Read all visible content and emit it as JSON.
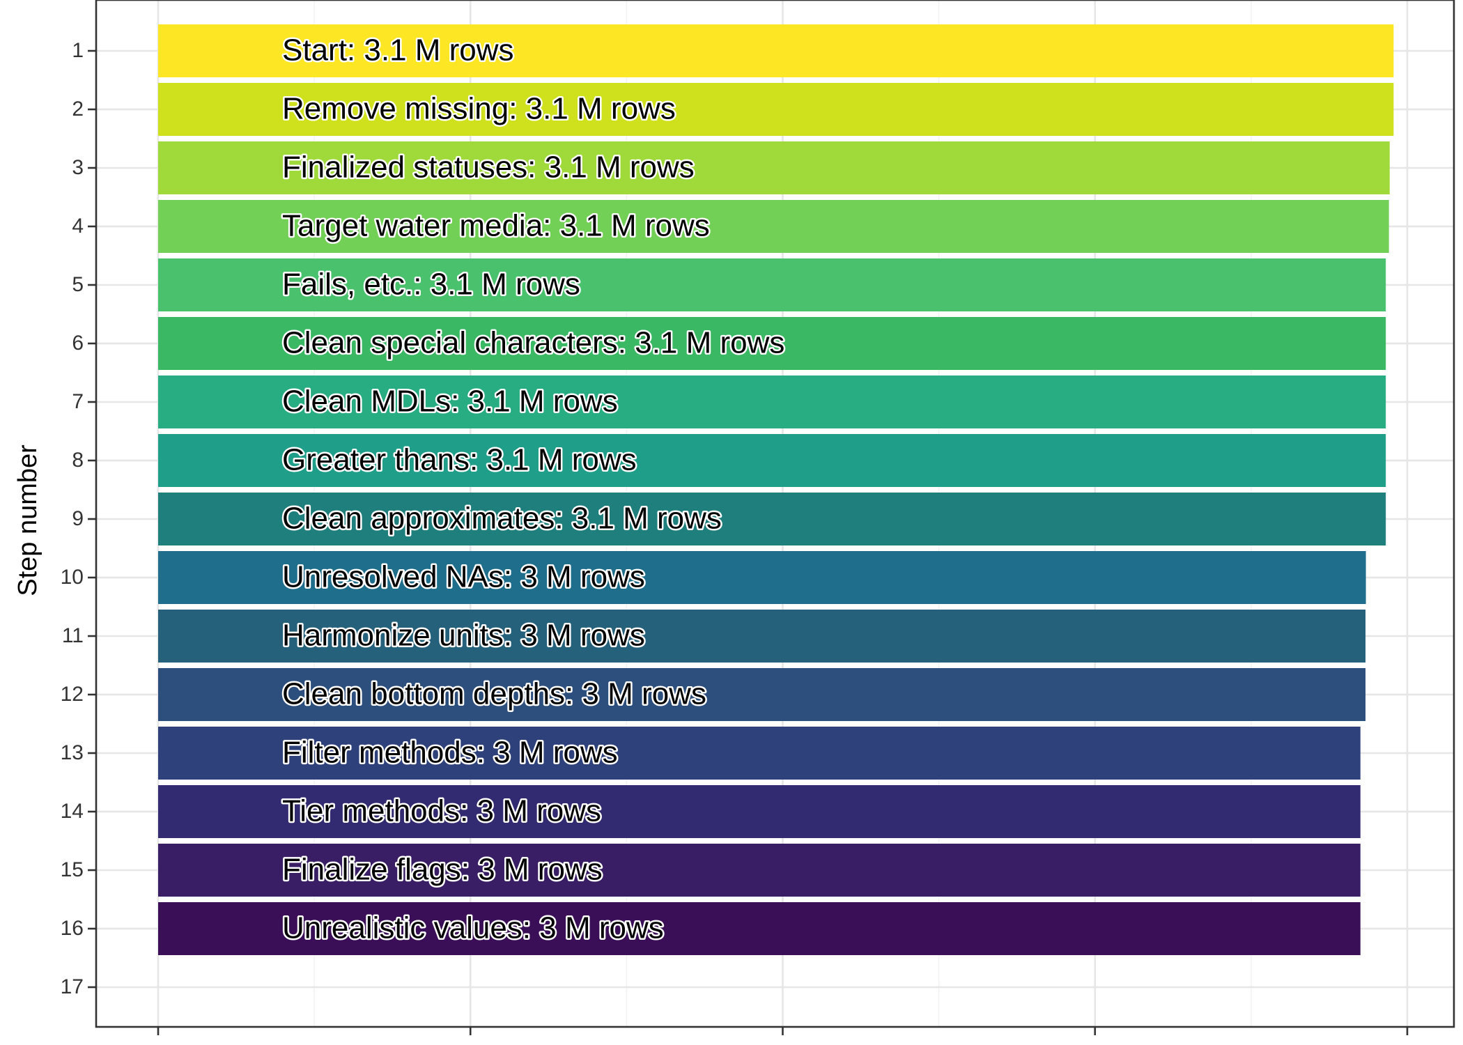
{
  "chart_data": {
    "type": "bar",
    "orientation": "horizontal",
    "ylabel": "Step number",
    "xlabel": "",
    "y_ticks": [
      "1",
      "2",
      "3",
      "4",
      "5",
      "6",
      "7",
      "8",
      "9",
      "10",
      "11",
      "12",
      "13",
      "14",
      "15",
      "16",
      "17"
    ],
    "xlim": [
      0,
      3.2
    ],
    "x_ticks_count": 5,
    "grid": true,
    "bars": [
      {
        "step": 1,
        "label": "Start:  3.1 M rows",
        "value": 3.165,
        "color": "#FDE725"
      },
      {
        "step": 2,
        "label": "Remove missing:  3.1 M rows",
        "value": 3.165,
        "color": "#CFE11C"
      },
      {
        "step": 3,
        "label": "Finalized statuses:  3.1 M rows",
        "value": 3.155,
        "color": "#9FDA3A"
      },
      {
        "step": 4,
        "label": "Target water media:  3.1 M rows",
        "value": 3.153,
        "color": "#73D056"
      },
      {
        "step": 5,
        "label": "Fails, etc.:  3.1 M rows",
        "value": 3.145,
        "color": "#4AC16D"
      },
      {
        "step": 6,
        "label": "Clean special characters:  3.1 M rows",
        "value": 3.145,
        "color": "#3BB864"
      },
      {
        "step": 7,
        "label": "Clean MDLs:  3.1 M rows",
        "value": 3.145,
        "color": "#27AD81"
      },
      {
        "step": 8,
        "label": "Greater thans:  3.1 M rows",
        "value": 3.145,
        "color": "#1F9E89"
      },
      {
        "step": 9,
        "label": "Clean approximates:  3.1 M rows",
        "value": 3.145,
        "color": "#1F7F7C"
      },
      {
        "step": 10,
        "label": "Unresolved NAs:  3 M rows",
        "value": 3.094,
        "color": "#1F6E8C"
      },
      {
        "step": 11,
        "label": "Harmonize units:  3 M rows",
        "value": 3.093,
        "color": "#26617C"
      },
      {
        "step": 12,
        "label": "Clean bottom depths:  3 M rows",
        "value": 3.093,
        "color": "#2D4F7E"
      },
      {
        "step": 13,
        "label": "Filter methods:  3 M rows",
        "value": 3.08,
        "color": "#2F417B"
      },
      {
        "step": 14,
        "label": "Tier methods:  3 M rows",
        "value": 3.08,
        "color": "#332B72"
      },
      {
        "step": 15,
        "label": "Finalize flags:  3 M rows",
        "value": 3.08,
        "color": "#391E66"
      },
      {
        "step": 16,
        "label": "Unrealistic values:  3 M rows",
        "value": 3.08,
        "color": "#3B0F57"
      }
    ]
  }
}
